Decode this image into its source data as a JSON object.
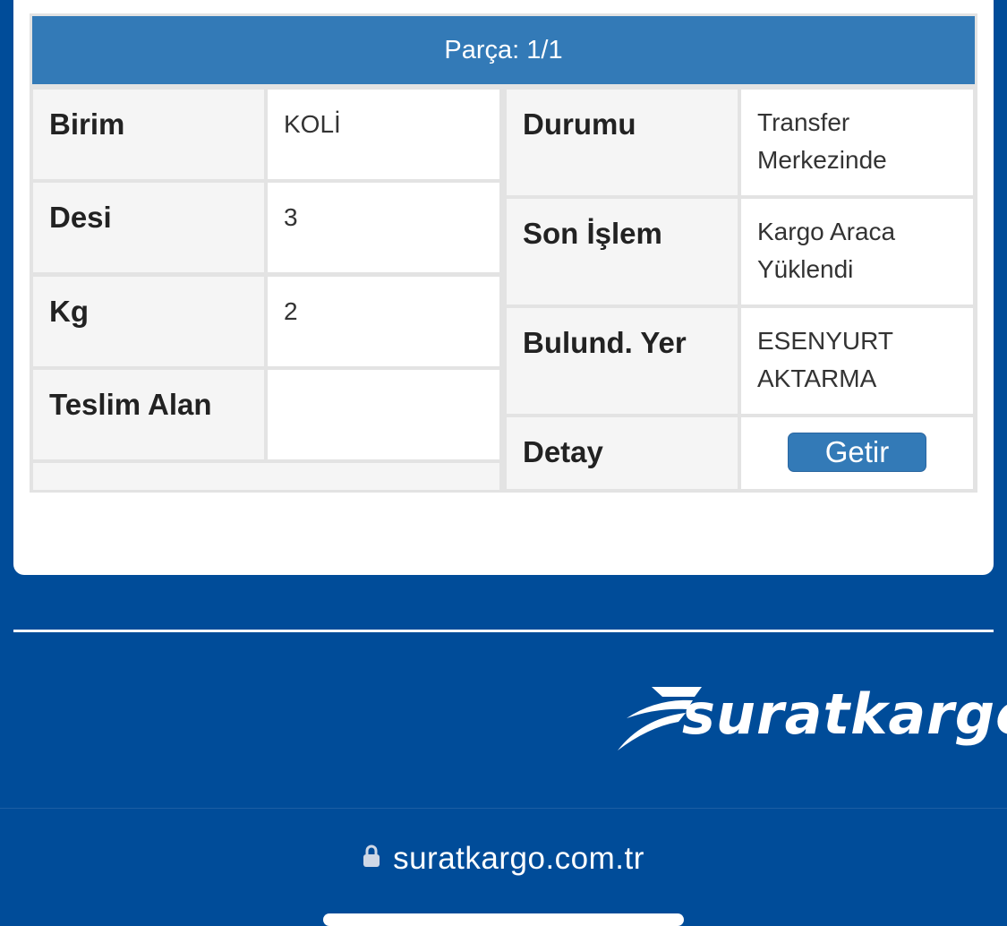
{
  "panel": {
    "header": "Parça: 1/1"
  },
  "left_table": [
    {
      "label": "Birim",
      "value": "KOLİ"
    },
    {
      "label": "Desi",
      "value": "3"
    },
    {
      "label": "Kg",
      "value": "2"
    },
    {
      "label": "Teslim Alan",
      "value": ""
    }
  ],
  "right_table": [
    {
      "label": "Durumu",
      "value": "Transfer Merkezinde"
    },
    {
      "label": "Son İşlem",
      "value": "Kargo Araca Yüklendi"
    },
    {
      "label": "Bulund. Yer",
      "value": "ESENYURT AKTARMA"
    },
    {
      "label": "Detay",
      "button": "Getir"
    }
  ],
  "footer": {
    "logo_text": "suratkargo"
  },
  "browser": {
    "url": "suratkargo.com.tr",
    "icon": "lock-icon"
  },
  "colors": {
    "brand_blue": "#004c99",
    "header_blue": "#337ab7"
  }
}
